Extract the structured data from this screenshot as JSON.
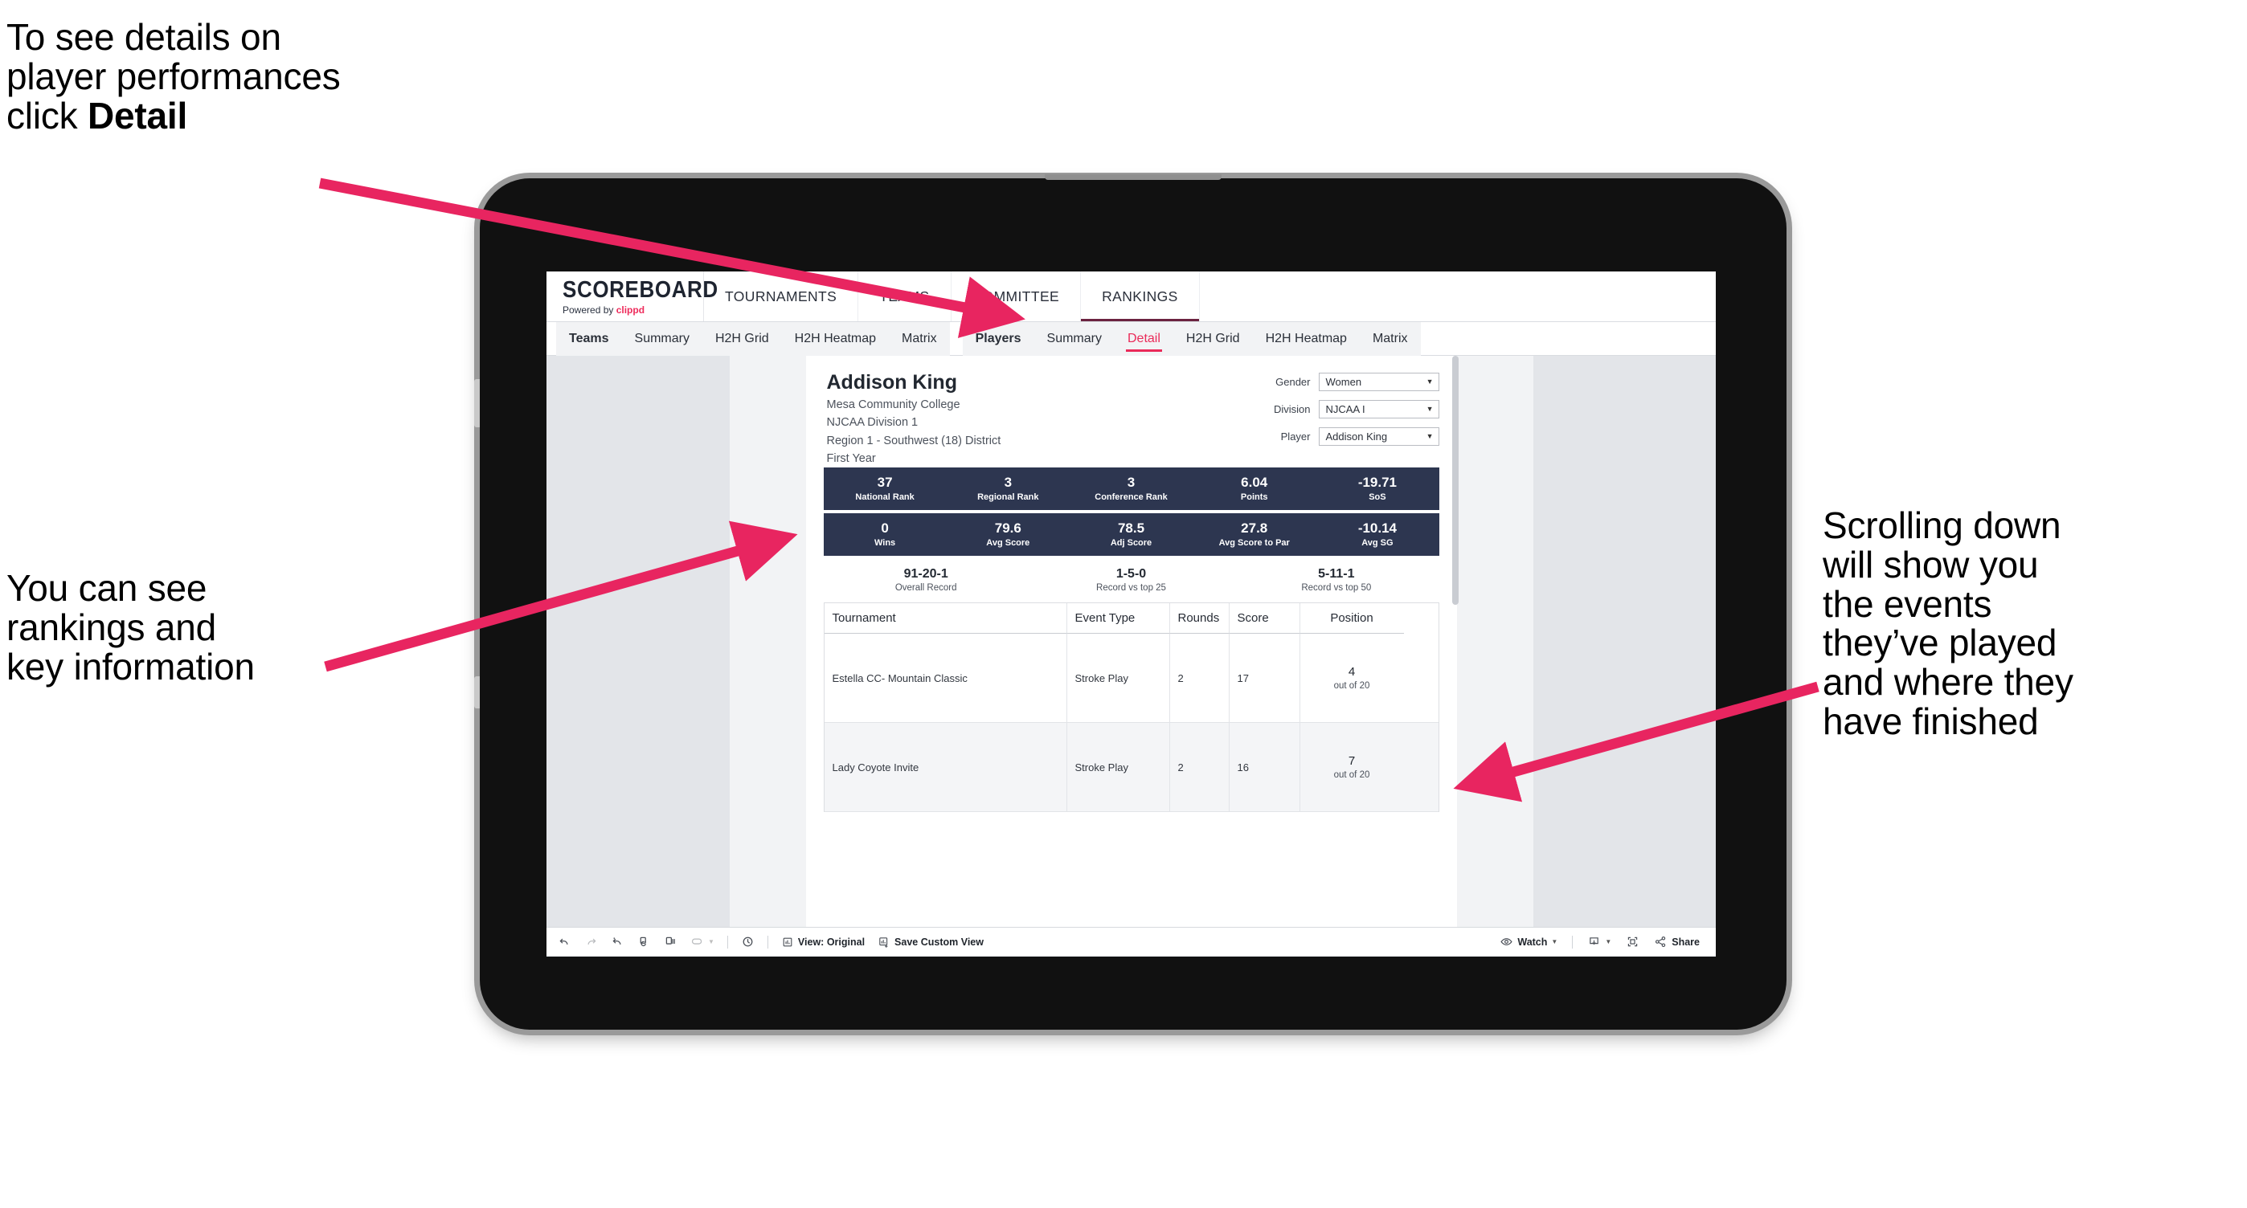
{
  "annotations": {
    "top_left": {
      "line1": "To see details on",
      "line2": "player performances",
      "line3_prefix": "click ",
      "line3_bold": "Detail"
    },
    "mid_left": {
      "line1": "You can see",
      "line2": "rankings and",
      "line3": "key information"
    },
    "right": {
      "line1": "Scrolling down",
      "line2": "will show you",
      "line3": "the events",
      "line4": "they’ve played",
      "line5": "and where they",
      "line6": "have finished"
    }
  },
  "app": {
    "brand": {
      "name": "SCOREBOARD",
      "powered_prefix": "Powered by ",
      "powered_brand": "clippd"
    },
    "top_nav": [
      {
        "label": "TOURNAMENTS",
        "active": false
      },
      {
        "label": "TEAMS",
        "active": false
      },
      {
        "label": "COMMITTEE",
        "active": false
      },
      {
        "label": "RANKINGS",
        "active": true
      }
    ],
    "sub_nav": {
      "group1": [
        {
          "label": "Teams",
          "active": false,
          "group_label": true
        },
        {
          "label": "Summary",
          "active": false
        },
        {
          "label": "H2H Grid",
          "active": false
        },
        {
          "label": "H2H Heatmap",
          "active": false
        },
        {
          "label": "Matrix",
          "active": false
        }
      ],
      "group2": [
        {
          "label": "Players",
          "active": false,
          "group_label": true
        },
        {
          "label": "Summary",
          "active": false
        },
        {
          "label": "Detail",
          "active": true
        },
        {
          "label": "H2H Grid",
          "active": false
        },
        {
          "label": "H2H Heatmap",
          "active": false
        },
        {
          "label": "Matrix",
          "active": false
        }
      ]
    },
    "accent_color": "#ea2a59",
    "stat_bar_color": "#2d3650"
  },
  "player": {
    "name": "Addison King",
    "school": "Mesa Community College",
    "division": "NJCAA Division 1",
    "region": "Region 1 - Southwest (18) District",
    "year": "First Year"
  },
  "filters": [
    {
      "label": "Gender",
      "value": "Women"
    },
    {
      "label": "Division",
      "value": "NJCAA I"
    },
    {
      "label": "Player",
      "value": "Addison King"
    }
  ],
  "stats_row1": [
    {
      "value": "37",
      "label": "National Rank"
    },
    {
      "value": "3",
      "label": "Regional Rank"
    },
    {
      "value": "3",
      "label": "Conference Rank"
    },
    {
      "value": "6.04",
      "label": "Points"
    },
    {
      "value": "-19.71",
      "label": "SoS"
    }
  ],
  "stats_row2": [
    {
      "value": "0",
      "label": "Wins"
    },
    {
      "value": "79.6",
      "label": "Avg Score"
    },
    {
      "value": "78.5",
      "label": "Adj Score"
    },
    {
      "value": "27.8",
      "label": "Avg Score to Par"
    },
    {
      "value": "-10.14",
      "label": "Avg SG"
    }
  ],
  "records": [
    {
      "value": "91-20-1",
      "label": "Overall Record"
    },
    {
      "value": "1-5-0",
      "label": "Record vs top 25"
    },
    {
      "value": "5-11-1",
      "label": "Record vs top 50"
    }
  ],
  "table": {
    "headers": [
      "Tournament",
      "Event Type",
      "Rounds",
      "Score",
      "Position"
    ],
    "rows": [
      {
        "tournament": "Estella CC- Mountain Classic",
        "event_type": "Stroke Play",
        "rounds": "2",
        "score": "17",
        "position": "4",
        "position_sub": "out of 20"
      },
      {
        "tournament": "Lady Coyote Invite",
        "event_type": "Stroke Play",
        "rounds": "2",
        "score": "16",
        "position": "7",
        "position_sub": "out of 20"
      }
    ]
  },
  "toolbar": {
    "view_label": "View: Original",
    "save_label": "Save Custom View",
    "watch_label": "Watch",
    "share_label": "Share"
  }
}
